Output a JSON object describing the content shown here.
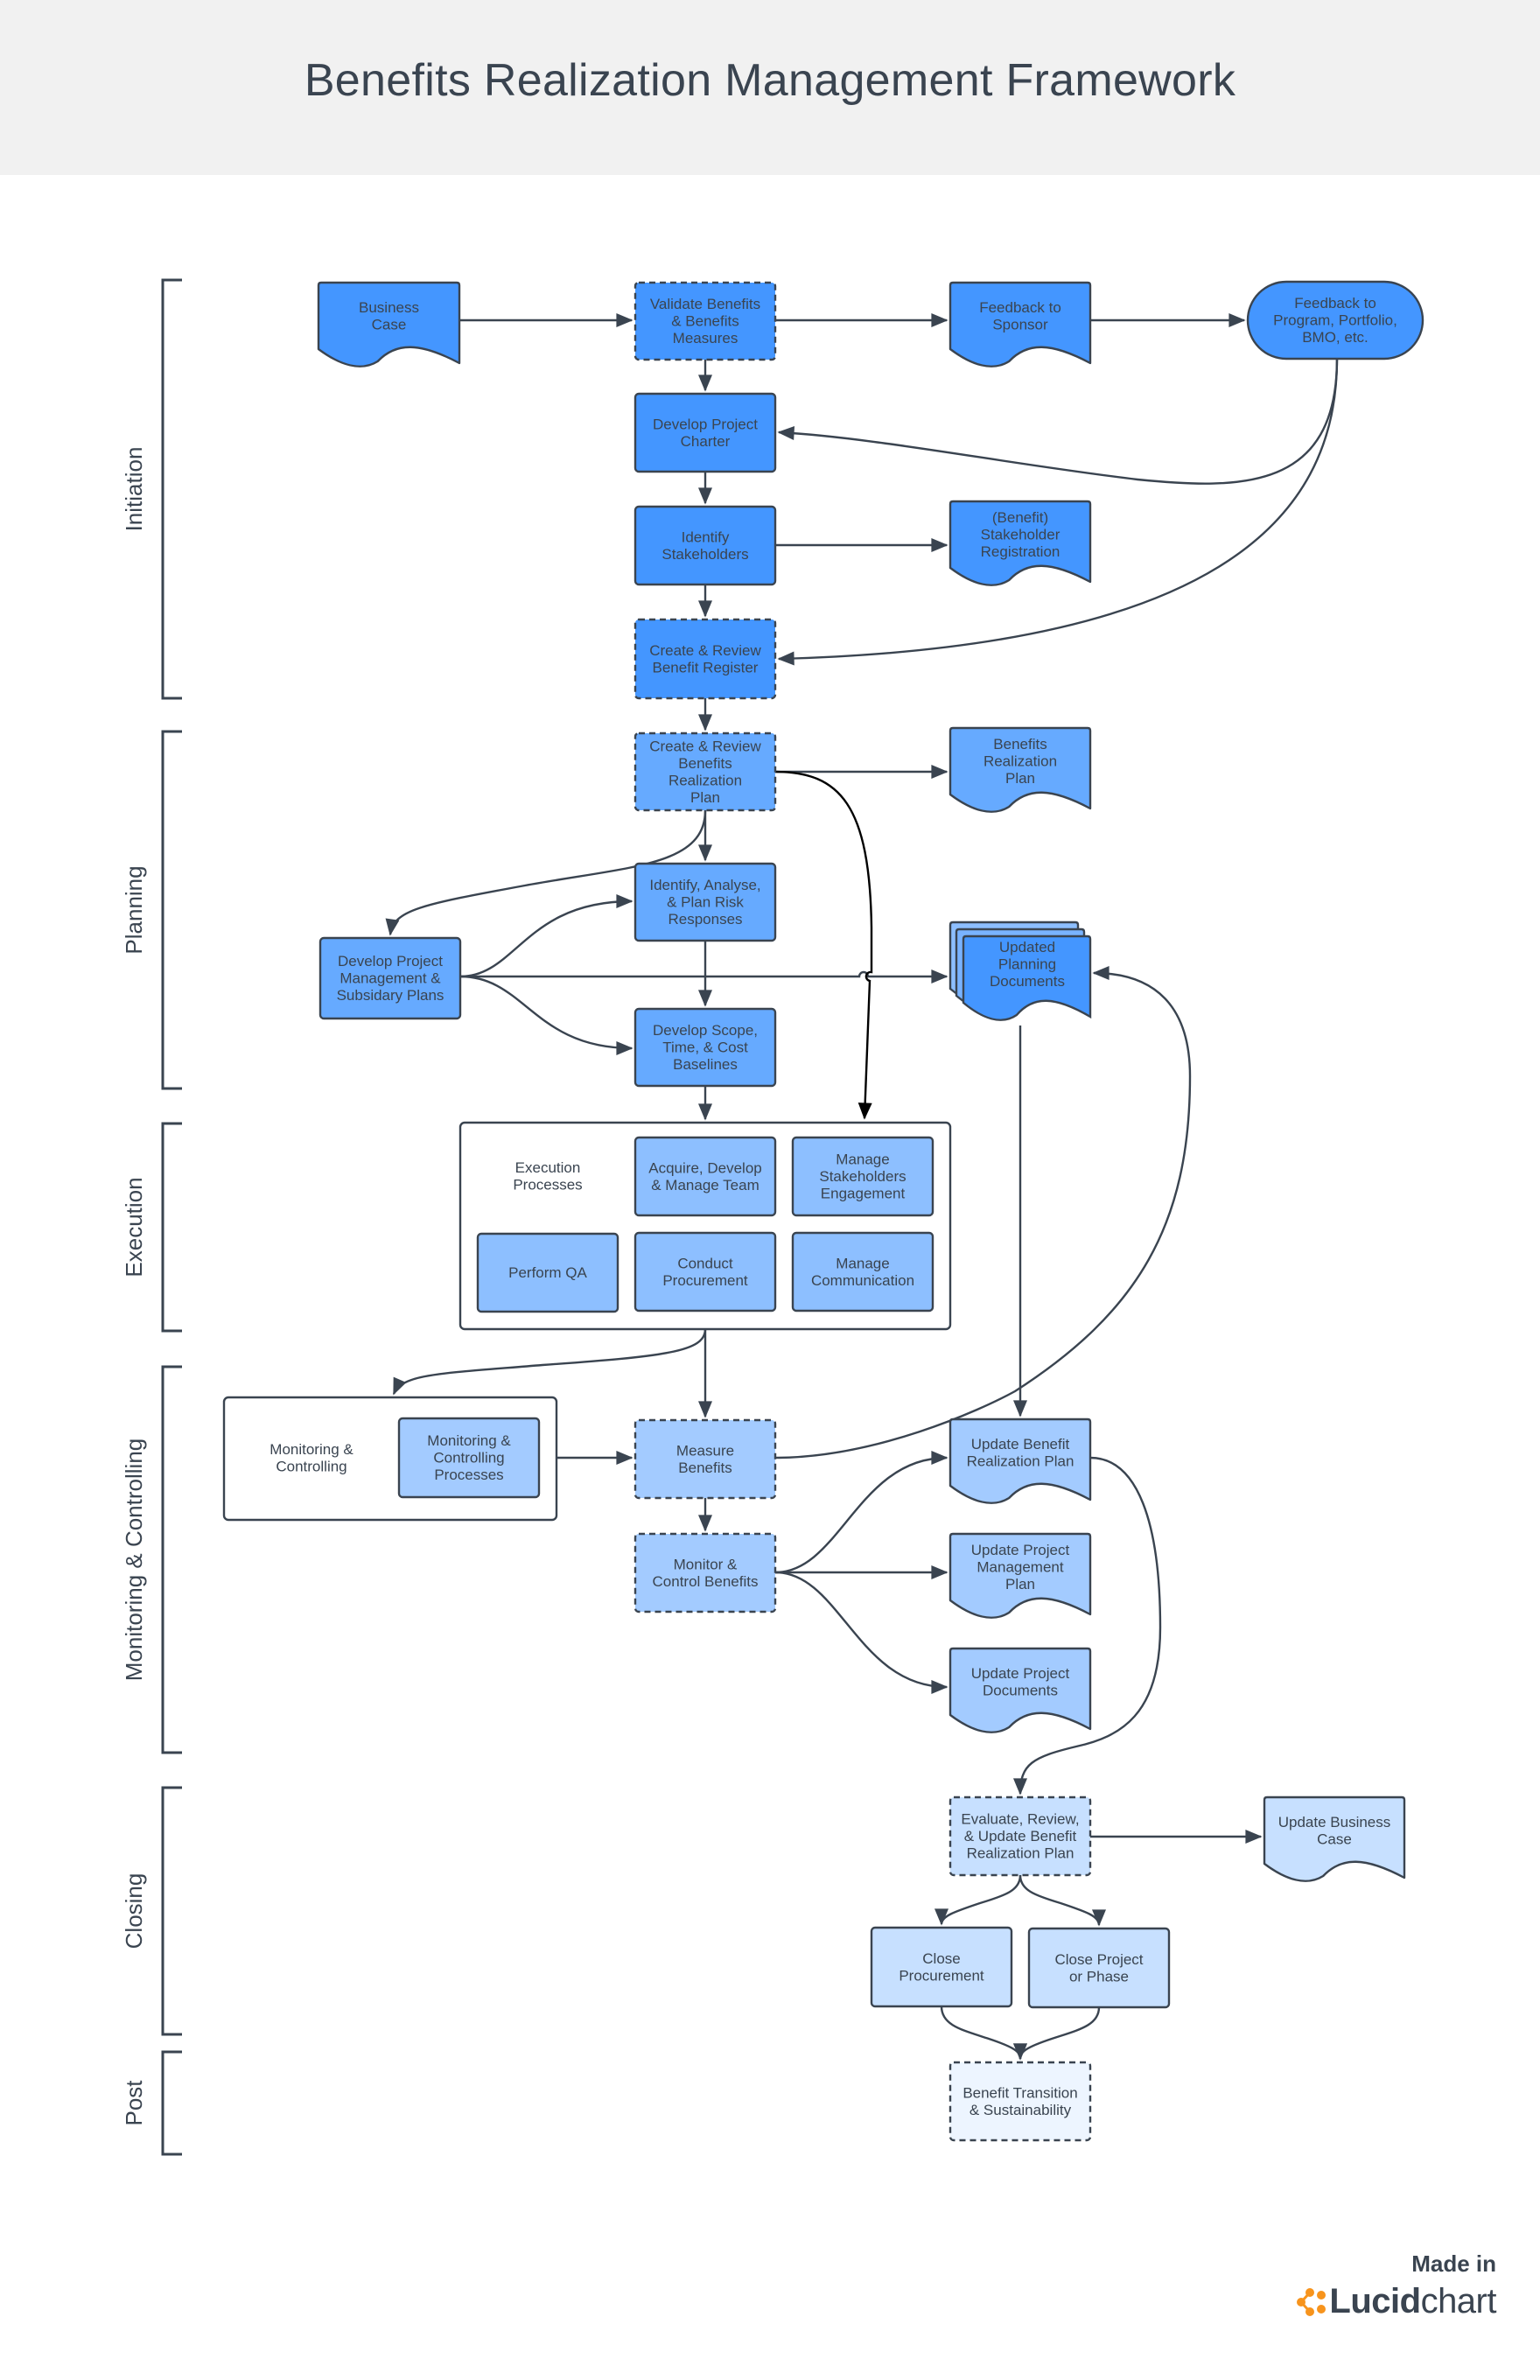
{
  "header": {
    "title": "Benefits Realization Management Framework"
  },
  "colors": {
    "stroke": "#3a4450",
    "initiation_fill": "#4496ff",
    "planning_fill": "#66aaff",
    "execution_fill": "#8dbfff",
    "monitoring_fill": "#a3cbff",
    "closing_fill": "#c7e0ff",
    "post_fill": "#edf5ff",
    "header_bg": "#f1f1f1",
    "logo_orange": "#f7941d"
  },
  "phases": [
    {
      "id": "initiation",
      "label": "Initiation"
    },
    {
      "id": "planning",
      "label": "Planning"
    },
    {
      "id": "execution",
      "label": "Execution"
    },
    {
      "id": "monitoring",
      "label": "Monitoring & Controlling"
    },
    {
      "id": "closing",
      "label": "Closing"
    },
    {
      "id": "post",
      "label": "Post"
    }
  ],
  "nodes": {
    "business_case": {
      "lines": [
        "Business",
        "Case"
      ],
      "shape": "document",
      "phase": "initiation"
    },
    "validate_benefits": {
      "lines": [
        "Validate Benefits",
        "& Benefits",
        "Measures"
      ],
      "shape": "process-dashed",
      "phase": "initiation"
    },
    "feedback_sponsor": {
      "lines": [
        "Feedback to",
        "Sponsor"
      ],
      "shape": "document",
      "phase": "initiation"
    },
    "feedback_program": {
      "lines": [
        "Feedback to",
        "Program, Portfolio,",
        "BMO, etc."
      ],
      "shape": "terminator",
      "phase": "initiation"
    },
    "develop_charter": {
      "lines": [
        "Develop Project",
        "Charter"
      ],
      "shape": "process",
      "phase": "initiation"
    },
    "identify_stakeholders": {
      "lines": [
        "Identify",
        "Stakeholders"
      ],
      "shape": "process",
      "phase": "initiation"
    },
    "stakeholder_registration": {
      "lines": [
        "(Benefit)",
        "Stakeholder",
        "Registration"
      ],
      "shape": "document",
      "phase": "initiation"
    },
    "benefit_register": {
      "lines": [
        "Create & Review",
        "Benefit Register"
      ],
      "shape": "process-dashed",
      "phase": "initiation"
    },
    "create_brp": {
      "lines": [
        "Create & Review",
        "Benefits",
        "Realization",
        "Plan"
      ],
      "shape": "process-dashed",
      "phase": "planning"
    },
    "brp_doc": {
      "lines": [
        "Benefits",
        "Realization",
        "Plan"
      ],
      "shape": "document",
      "phase": "planning"
    },
    "risk_responses": {
      "lines": [
        "Identify, Analyse,",
        "& Plan Risk",
        "Responses"
      ],
      "shape": "process",
      "phase": "planning"
    },
    "develop_pm_plans": {
      "lines": [
        "Develop Project",
        "Management &",
        "Subsidary Plans"
      ],
      "shape": "process",
      "phase": "planning"
    },
    "updated_planning_docs": {
      "lines": [
        "Updated",
        "Planning",
        "Documents"
      ],
      "shape": "multi-document",
      "phase": "planning"
    },
    "scope_baselines": {
      "lines": [
        "Develop Scope,",
        "Time, & Cost",
        "Baselines"
      ],
      "shape": "process",
      "phase": "planning"
    },
    "execution_group": {
      "lines": [
        "Execution",
        "Processes"
      ],
      "shape": "container",
      "phase": "execution"
    },
    "acquire_team": {
      "lines": [
        "Acquire, Develop",
        "& Manage Team"
      ],
      "shape": "process",
      "phase": "execution"
    },
    "manage_stakeholders": {
      "lines": [
        "Manage",
        "Stakeholders",
        "Engagement"
      ],
      "shape": "process",
      "phase": "execution"
    },
    "perform_qa": {
      "lines": [
        "Perform QA"
      ],
      "shape": "process",
      "phase": "execution"
    },
    "conduct_procurement": {
      "lines": [
        "Conduct",
        "Procurement"
      ],
      "shape": "process",
      "phase": "execution"
    },
    "manage_communication": {
      "lines": [
        "Manage",
        "Communication"
      ],
      "shape": "process",
      "phase": "execution"
    },
    "mc_group": {
      "lines": [
        "Monitoring &",
        "Controlling"
      ],
      "shape": "container",
      "phase": "monitoring"
    },
    "mc_processes": {
      "lines": [
        "Monitoring &",
        "Controlling",
        "Processes"
      ],
      "shape": "process",
      "phase": "monitoring"
    },
    "measure_benefits": {
      "lines": [
        "Measure",
        "Benefits"
      ],
      "shape": "process-dashed",
      "phase": "monitoring"
    },
    "monitor_control": {
      "lines": [
        "Monitor &",
        "Control Benefits"
      ],
      "shape": "process-dashed",
      "phase": "monitoring"
    },
    "update_brp": {
      "lines": [
        "Update Benefit",
        "Realization Plan"
      ],
      "shape": "document",
      "phase": "monitoring"
    },
    "update_pm_plan": {
      "lines": [
        "Update Project",
        "Management",
        "Plan"
      ],
      "shape": "document",
      "phase": "monitoring"
    },
    "update_project_docs": {
      "lines": [
        "Update Project",
        "Documents"
      ],
      "shape": "document",
      "phase": "monitoring"
    },
    "evaluate_brp": {
      "lines": [
        "Evaluate, Review,",
        "& Update Benefit",
        "Realization Plan"
      ],
      "shape": "process-dashed",
      "phase": "closing"
    },
    "update_business_case": {
      "lines": [
        "Update Business",
        "Case"
      ],
      "shape": "document",
      "phase": "closing"
    },
    "close_procurement": {
      "lines": [
        "Close",
        "Procurement"
      ],
      "shape": "process",
      "phase": "closing"
    },
    "close_project": {
      "lines": [
        "Close Project",
        "or Phase"
      ],
      "shape": "process",
      "phase": "closing"
    },
    "benefit_transition": {
      "lines": [
        "Benefit Transition",
        "& Sustainability"
      ],
      "shape": "process-dashed",
      "phase": "post"
    }
  },
  "edges": [
    [
      "business_case",
      "validate_benefits"
    ],
    [
      "validate_benefits",
      "feedback_sponsor"
    ],
    [
      "feedback_sponsor",
      "feedback_program"
    ],
    [
      "validate_benefits",
      "develop_charter"
    ],
    [
      "feedback_program",
      "develop_charter"
    ],
    [
      "develop_charter",
      "identify_stakeholders"
    ],
    [
      "identify_stakeholders",
      "stakeholder_registration"
    ],
    [
      "identify_stakeholders",
      "benefit_register"
    ],
    [
      "feedback_program",
      "benefit_register"
    ],
    [
      "benefit_register",
      "create_brp"
    ],
    [
      "create_brp",
      "brp_doc"
    ],
    [
      "create_brp",
      "risk_responses"
    ],
    [
      "create_brp",
      "develop_pm_plans"
    ],
    [
      "create_brp",
      "manage_stakeholders"
    ],
    [
      "develop_pm_plans",
      "risk_responses"
    ],
    [
      "develop_pm_plans",
      "updated_planning_docs"
    ],
    [
      "develop_pm_plans",
      "scope_baselines"
    ],
    [
      "risk_responses",
      "scope_baselines"
    ],
    [
      "scope_baselines",
      "execution_group"
    ],
    [
      "execution_group",
      "measure_benefits"
    ],
    [
      "execution_group",
      "mc_group"
    ],
    [
      "mc_group",
      "measure_benefits"
    ],
    [
      "measure_benefits",
      "updated_planning_docs"
    ],
    [
      "updated_planning_docs",
      "update_brp"
    ],
    [
      "measure_benefits",
      "monitor_control"
    ],
    [
      "monitor_control",
      "update_brp"
    ],
    [
      "monitor_control",
      "update_pm_plan"
    ],
    [
      "monitor_control",
      "update_project_docs"
    ],
    [
      "update_brp",
      "evaluate_brp"
    ],
    [
      "evaluate_brp",
      "update_business_case"
    ],
    [
      "evaluate_brp",
      "close_procurement"
    ],
    [
      "evaluate_brp",
      "close_project"
    ],
    [
      "close_procurement",
      "benefit_transition"
    ],
    [
      "close_project",
      "benefit_transition"
    ]
  ],
  "footer": {
    "made_in": "Made in",
    "brand_bold": "Lucid",
    "brand_light": "chart"
  }
}
